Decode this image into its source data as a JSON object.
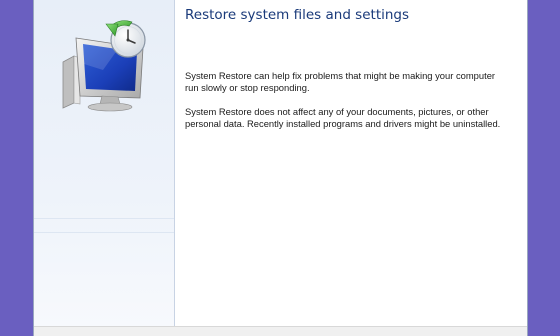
{
  "wizard": {
    "title": "Restore system files and settings",
    "paragraph1": "System Restore can help fix problems that might be making your computer run slowly or stop responding.",
    "paragraph2": "System Restore does not affect any of your documents, pictures, or other personal data. Recently installed programs and drivers might be uninstalled.",
    "icon": "system-restore-icon"
  },
  "colors": {
    "desktop": "#6a5fc0",
    "title": "#1a3a7a",
    "side_panel": "#e7eef8"
  }
}
